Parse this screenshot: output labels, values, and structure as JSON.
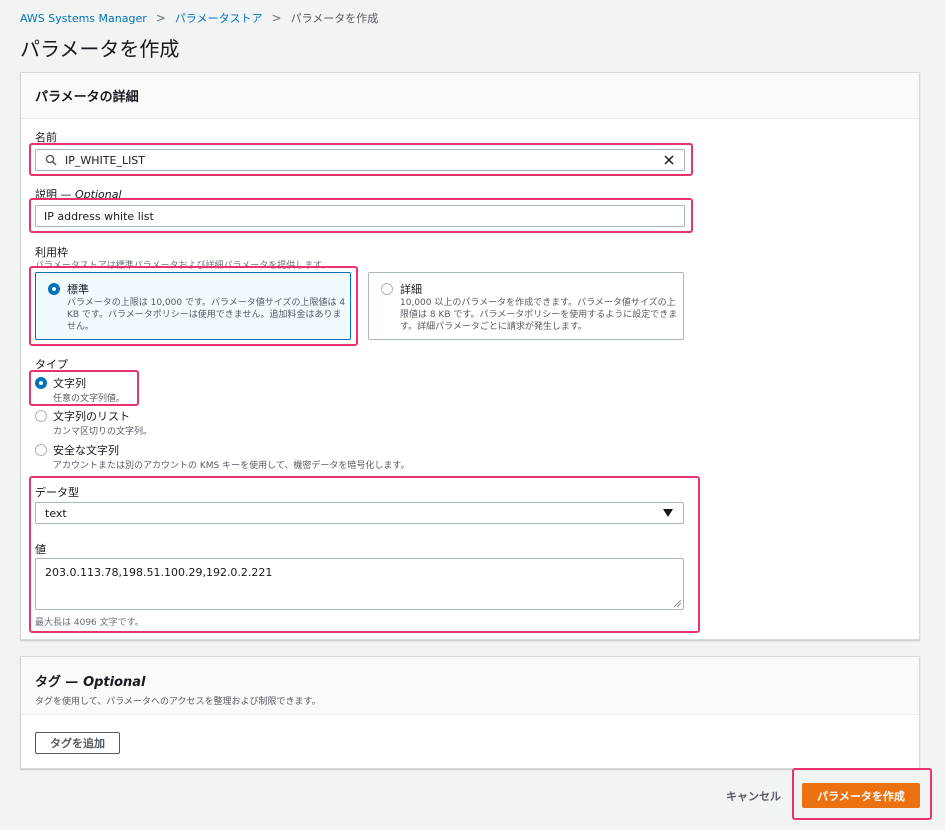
{
  "breadcrumb": {
    "items": [
      "AWS Systems Manager",
      "パラメータストア",
      "パラメータを作成"
    ],
    "separator": ">"
  },
  "page": {
    "title": "パラメータを作成"
  },
  "details": {
    "title": "パラメータの詳細",
    "name": {
      "label": "名前",
      "value": "IP_WHITE_LIST",
      "search_icon": "search-icon",
      "clear_icon": "close-icon"
    },
    "description": {
      "label": "説明",
      "optional": "— Optional",
      "value": "IP address white list"
    },
    "tier": {
      "label": "利用枠",
      "description": "パラメータストアは標準パラメータおよび詳細パラメータを提供します。",
      "options": [
        {
          "title": "標準",
          "desc_line1": "パラメータの上限は 10,000 です。パラメータ値サイズの上限値は 4",
          "desc_line2": "KB です。パラメータポリシーは使用できません。追加料金はありま",
          "desc_line3": "せん。",
          "selected": true
        },
        {
          "title": "詳細",
          "desc_line1": "10,000 以上のパラメータを作成できます。パラメータ値サイズの上",
          "desc_line2": "限値は 8 KB です。パラメータポリシーを使用するように設定できま",
          "desc_line3": "す。詳細パラメータごとに請求が発生します。",
          "selected": false
        }
      ]
    },
    "type": {
      "label": "タイプ",
      "options": [
        {
          "title": "文字列",
          "desc": "任意の文字列値。",
          "selected": true
        },
        {
          "title": "文字列のリスト",
          "desc": "カンマ区切りの文字列。",
          "selected": false
        },
        {
          "title": "安全な文字列",
          "desc": "アカウントまたは別のアカウントの KMS キーを使用して、機密データを暗号化します。",
          "selected": false
        }
      ]
    },
    "data_type": {
      "label": "データ型",
      "value": "text",
      "arrow_icon": "caret-down-icon"
    },
    "value": {
      "label": "値",
      "value": "203.0.113.78,198.51.100.29,192.0.2.221",
      "hint": "最大長は 4096 文字です。"
    }
  },
  "tags": {
    "title": "タグ",
    "optional": "— Optional",
    "description": "タグを使用して、パラメータへのアクセスを整理および制限できます。",
    "add_button": "タグを追加"
  },
  "footer": {
    "cancel": "キャンセル",
    "create": "パラメータを作成"
  },
  "colors": {
    "accent": "#0073bb",
    "primary_button": "#ec7211",
    "highlight": "#e8336d"
  }
}
